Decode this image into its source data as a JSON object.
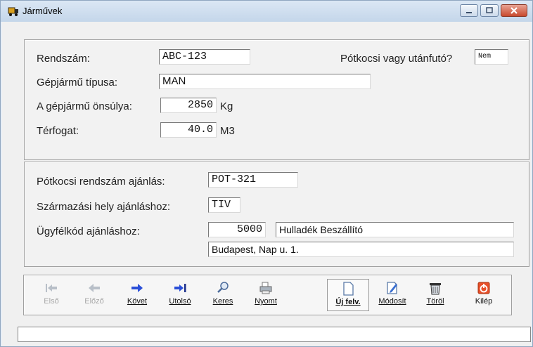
{
  "window": {
    "title": "Járművek"
  },
  "vehicle": {
    "plate_label": "Rendszám:",
    "plate_value": "ABC-123",
    "trailer_label": "Pótkocsi vagy utánfutó?",
    "trailer_value": "Nem",
    "type_label": "Gépjármű típusa:",
    "type_value": "MAN",
    "weight_label": "A gépjármű önsúlya:",
    "weight_value": "2850",
    "weight_unit": "Kg",
    "volume_label": "Térfogat:",
    "volume_value": "40.0",
    "volume_unit": "M3"
  },
  "suggest": {
    "trailer_plate_label": "Pótkocsi rendszám ajánlás:",
    "trailer_plate_value": "POT-321",
    "origin_label": "Származási hely ajánláshoz:",
    "origin_value": "TIV",
    "client_label": "Ügyfélkód ajánláshoz:",
    "client_code": "5000",
    "client_name": "Hulladék Beszállító",
    "client_address": "Budapest, Nap u. 1."
  },
  "toolbar": {
    "first": "Első",
    "prev": "Előző",
    "next": "Követ",
    "last": "Utolsó",
    "search": "Keres",
    "print": "Nyomt",
    "new": "Új felv.",
    "edit": "Módosít",
    "delete": "Töröl",
    "exit": "Kilép"
  },
  "status_text": ""
}
